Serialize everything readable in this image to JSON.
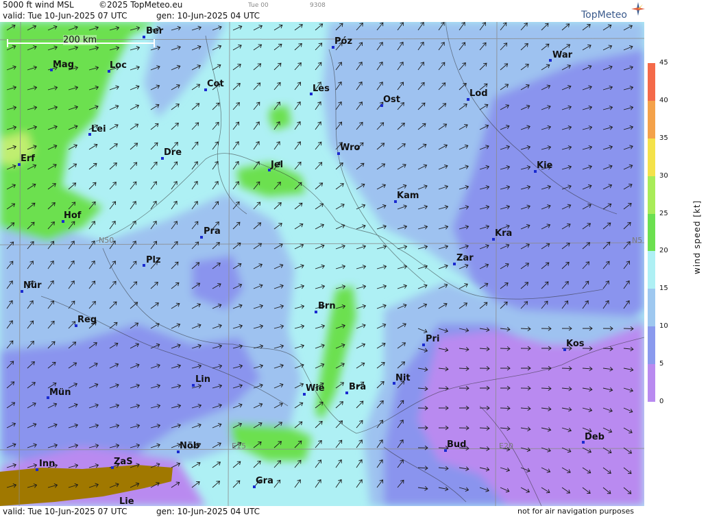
{
  "header": {
    "product": "5000 ft wind MSL",
    "copyright": "©2025 TopMeteo.eu",
    "run_label": "Tue 00",
    "code": "9308",
    "valid": "valid:  Tue  10-Jun-2025  07 UTC",
    "gen": "gen: 10-Jun-2025 04 UTC",
    "logo": "TopMeteo"
  },
  "footer": {
    "valid": "valid:  Tue  10-Jun-2025  07 UTC",
    "gen": "gen: 10-Jun-2025 04 UTC",
    "disclaimer": "not for air navigation purposes"
  },
  "scale_bar": "200 km",
  "grid_labels": {
    "lat": "N50",
    "lat_right": "N5",
    "lon1": "E15",
    "lon2": "E20"
  },
  "legend": {
    "title": "wind speed [kt]",
    "ticks": [
      "45",
      "40",
      "35",
      "30",
      "25",
      "20",
      "15",
      "10",
      "5",
      "0"
    ],
    "bands": [
      {
        "from": 40,
        "to": 45,
        "color": "#f46a4a"
      },
      {
        "from": 35,
        "to": 40,
        "color": "#f4a24a"
      },
      {
        "from": 30,
        "to": 35,
        "color": "#f4e24a"
      },
      {
        "from": 25,
        "to": 30,
        "color": "#a8ec58"
      },
      {
        "from": 20,
        "to": 25,
        "color": "#6ce050"
      },
      {
        "from": 15,
        "to": 20,
        "color": "#aef0f4"
      },
      {
        "from": 10,
        "to": 15,
        "color": "#9ec8f0"
      },
      {
        "from": 5,
        "to": 10,
        "color": "#8a9aee"
      },
      {
        "from": 0,
        "to": 5,
        "color": "#b98af0"
      }
    ]
  },
  "colors": {
    "band_0_5": "#b98af0",
    "band_5_10": "#8a94ee",
    "band_10_15": "#9ec2f0",
    "band_15_20": "#aef0f4",
    "band_20_25": "#6ce050",
    "terrain": "#a07800"
  },
  "cities": [
    {
      "name": "Ber"
    },
    {
      "name": "Póz"
    },
    {
      "name": "War"
    },
    {
      "name": "Mag"
    },
    {
      "name": "Loc"
    },
    {
      "name": "Cot"
    },
    {
      "name": "Les"
    },
    {
      "name": "Ost"
    },
    {
      "name": "Lod"
    },
    {
      "name": "Lei"
    },
    {
      "name": "Dre"
    },
    {
      "name": "Wro"
    },
    {
      "name": "Erf"
    },
    {
      "name": "Jel"
    },
    {
      "name": "Kie"
    },
    {
      "name": "Kam"
    },
    {
      "name": "Hof"
    },
    {
      "name": "Pra"
    },
    {
      "name": "Kra"
    },
    {
      "name": "Plz"
    },
    {
      "name": "Zar"
    },
    {
      "name": "Nür"
    },
    {
      "name": "Brn"
    },
    {
      "name": "Reg"
    },
    {
      "name": "Pri"
    },
    {
      "name": "Kos"
    },
    {
      "name": "Lin"
    },
    {
      "name": "Nit"
    },
    {
      "name": "Mün"
    },
    {
      "name": "Wie"
    },
    {
      "name": "Bra"
    },
    {
      "name": "Nöb"
    },
    {
      "name": "Bud"
    },
    {
      "name": "Deb"
    },
    {
      "name": "Inn"
    },
    {
      "name": "ZaS"
    },
    {
      "name": "Gra"
    },
    {
      "name": "Lie"
    }
  ],
  "wind_field": {
    "arrow_glyph": "→",
    "prevailing_direction": "from south-west",
    "arrow_spacing_note": "regular grid of wind arrows"
  }
}
